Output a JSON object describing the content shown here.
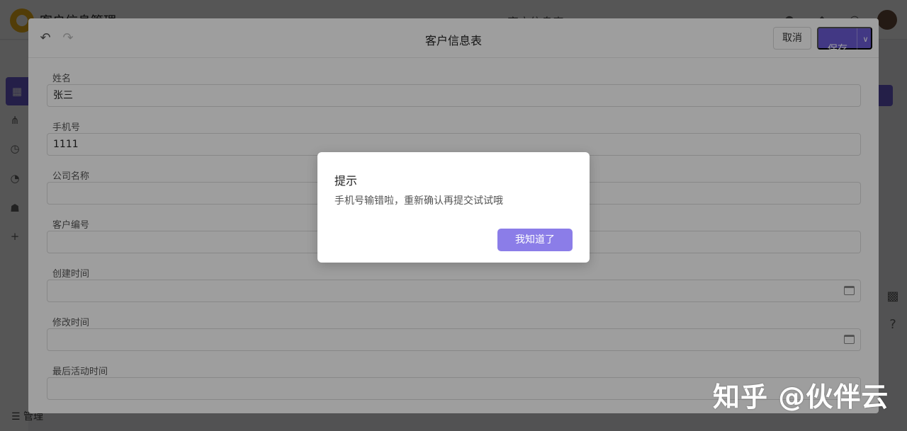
{
  "background_app": {
    "app_title": "客户信息管理",
    "center_title": "客户信息表",
    "sidebar_bottom_label": "管理"
  },
  "drawer": {
    "title": "客户信息表",
    "cancel_label": "取消",
    "save_label": "保存",
    "fields": [
      {
        "label": "姓名",
        "value": ""
      },
      {
        "label": "手机号",
        "value": ""
      },
      {
        "label": "公司名称",
        "value": ""
      },
      {
        "label": "客户编号",
        "value": ""
      },
      {
        "label": "创建时间",
        "value": ""
      },
      {
        "label": "修改时间",
        "value": ""
      },
      {
        "label": "最后活动时间",
        "value": ""
      }
    ],
    "values": {
      "name": "张三",
      "phone": "1111"
    }
  },
  "dialog": {
    "title": "提示",
    "message": "手机号输错啦，重新确认再提交试试哦",
    "ok_label": "我知道了"
  },
  "watermark": "知乎 @伙伴云",
  "colors": {
    "accent": "#6b5bd6",
    "dialog_button": "#8b7de8"
  }
}
